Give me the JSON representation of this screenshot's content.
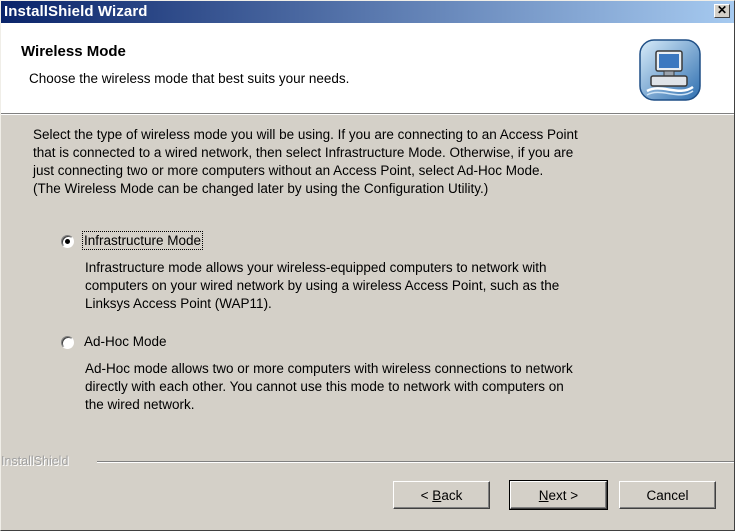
{
  "window": {
    "title": "InstallShield Wizard",
    "close_glyph": "✕"
  },
  "header": {
    "title": "Wireless Mode",
    "subtitle": "Choose the wireless mode that best suits your needs.",
    "icon": "computer-network-icon"
  },
  "instructions": [
    "Select the type of wireless mode you will be using. If you are connecting to an Access Point",
    "that is connected to a wired network, then select Infrastructure Mode. Otherwise, if you are",
    "just connecting two or more computers without an Access Point, select Ad-Hoc Mode.",
    "(The Wireless Mode can be changed later by using the Configuration Utility.)"
  ],
  "options": [
    {
      "label": "Infrastructure Mode",
      "selected": true,
      "description": [
        "Infrastructure mode allows your wireless-equipped computers to network with",
        "computers on your wired network by using a wireless Access Point, such as the",
        "Linksys Access Point (WAP11)."
      ]
    },
    {
      "label": "Ad-Hoc Mode",
      "selected": false,
      "description": [
        "Ad-Hoc mode allows two or more computers with wireless connections to network",
        "directly with each other. You cannot use this mode to network with computers on",
        "the wired network."
      ]
    }
  ],
  "branding": {
    "text": "InstallShield"
  },
  "buttons": {
    "back": {
      "prefix": "< ",
      "mnemonic": "B",
      "rest": "ack"
    },
    "next": {
      "mnemonic": "N",
      "rest": "ext >"
    },
    "cancel": {
      "label": "Cancel"
    }
  },
  "colors": {
    "titlebar_start": "#0a246a",
    "titlebar_end": "#a6caf0",
    "dialog_bg": "#d4d0c8"
  }
}
